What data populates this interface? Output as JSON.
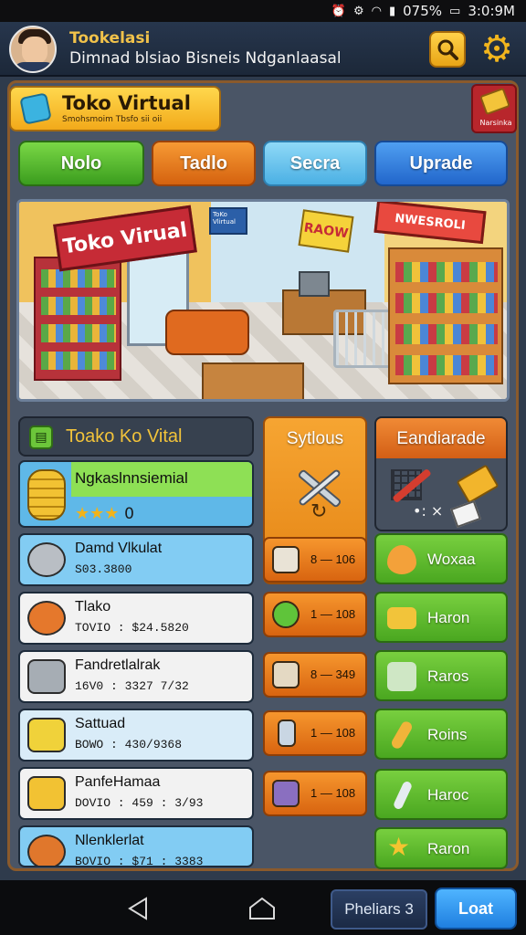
{
  "status_bar": {
    "battery": "075%",
    "time": "3:0:9M"
  },
  "header": {
    "title": "Tookelasi",
    "subtitle": "Dimnad blsiao Bisneis Ndganlaasal"
  },
  "store_banner": {
    "name": "Toko Virtual",
    "tagline": "Smohsmoim Tbsfo sii oii"
  },
  "badge": {
    "label": "Narsinka"
  },
  "tabs": [
    {
      "label": "Nolo"
    },
    {
      "label": "Tadlo"
    },
    {
      "label": "Secra"
    },
    {
      "label": "Uprade"
    }
  ],
  "scene": {
    "sign_main": "Toko Virual",
    "sign_center": "RAOW",
    "sign_right": "NWESROLI",
    "sign_small": "ToKo Vlirtual"
  },
  "inventory": {
    "title": "Toako Ko Vital",
    "featured": {
      "name": "Ngkaslnnsiemial",
      "stars": "★★★",
      "rating": "0"
    },
    "items": [
      {
        "name": "Damd Vlkulat",
        "sub": "S03.3800"
      },
      {
        "name": "Tlako",
        "sub": "TOVIO : $24.5820"
      },
      {
        "name": "Fandretlalrak",
        "sub": "16V0 : 3327 7/32"
      },
      {
        "name": "Sattuad",
        "sub": "BOWO : 430/9368"
      },
      {
        "name": "PanfeHamaa",
        "sub": "DOVIO : 459 : 3/93"
      },
      {
        "name": "Nlenklerlat",
        "sub": "BOVIO : $71 : 3383"
      }
    ]
  },
  "middle": {
    "title": "Sytlous",
    "arrow": "↻",
    "buttons": [
      {
        "label": "8 — 106"
      },
      {
        "label": "1 — 108"
      },
      {
        "label": "8 — 349"
      },
      {
        "label": "1 — 108"
      },
      {
        "label": "1 — 108"
      }
    ]
  },
  "right": {
    "title": "Eandiarade",
    "dots": "•: ×",
    "buttons": [
      {
        "label": "Woxaa"
      },
      {
        "label": "Haron"
      },
      {
        "label": "Raros"
      },
      {
        "label": "Roins"
      },
      {
        "label": "Haroc"
      },
      {
        "label": "Raron"
      }
    ]
  },
  "nav": {
    "button_1": "Pheliars 3",
    "button_2": "Loat"
  },
  "colors": {
    "accent_gold": "#f2c33a",
    "tab_green": "#3b9d1e",
    "tab_orange": "#d5620f",
    "tab_sky": "#4bb0e4",
    "tab_blue": "#2266cb",
    "panel_bg": "#4a5566"
  }
}
